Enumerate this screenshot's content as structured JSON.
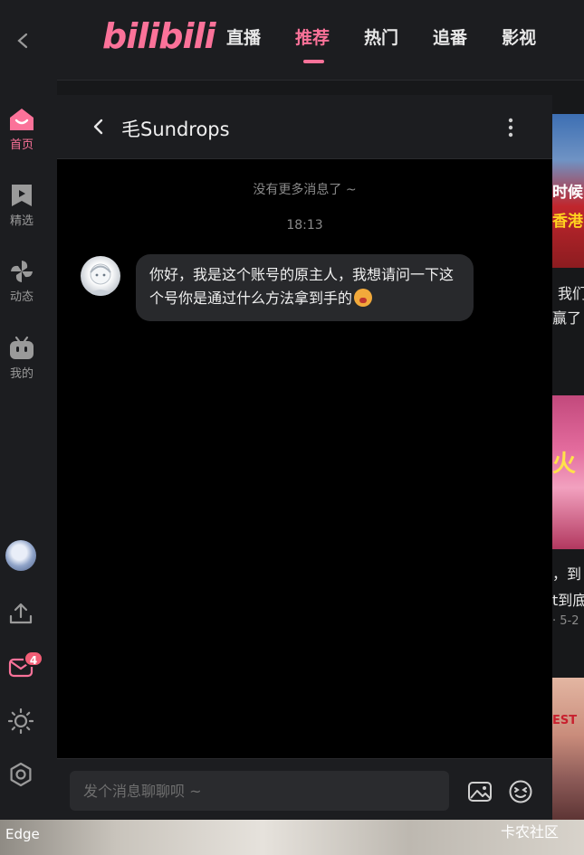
{
  "app": {
    "logo": "bilibili"
  },
  "header": {
    "tabs": [
      {
        "label": "直播",
        "active": false
      },
      {
        "label": "推荐",
        "active": true
      },
      {
        "label": "热门",
        "active": false
      },
      {
        "label": "追番",
        "active": false
      },
      {
        "label": "影视",
        "active": false
      }
    ]
  },
  "sidebar": {
    "items": [
      {
        "label": "首页",
        "icon": "home-icon",
        "active": true
      },
      {
        "label": "精选",
        "icon": "featured-icon",
        "active": false
      },
      {
        "label": "动态",
        "icon": "pinwheel-icon",
        "active": false
      },
      {
        "label": "我的",
        "icon": "tv-face-icon",
        "active": false
      }
    ],
    "message_badge": "4"
  },
  "chat": {
    "title": "毛Sundrops",
    "no_more": "没有更多消息了 ~",
    "time": "18:13",
    "message": "你好，我是这个账号的原主人，我想请问一下这个号你是通过什么方法拿到手的",
    "input_placeholder": "发个消息聊聊呗 ~"
  },
  "feed": {
    "thumb1_line1": "时候",
    "thumb1_line2": "香港",
    "text1_line1": "我们",
    "text1_line2": "赢了",
    "thumb2_caption": "火",
    "text2_line1": "，到",
    "text2_line2": "t到底",
    "text2_meta": "· 5-2",
    "thumb3_caption": "EST"
  },
  "taskbar": {
    "left_label": "Edge",
    "right_label": "卡农社区"
  },
  "colors": {
    "accent": "#fb7299",
    "badge": "#f25d75",
    "panel": "#1c1d20",
    "chat_bg": "#000000",
    "bubble": "#28292c"
  }
}
